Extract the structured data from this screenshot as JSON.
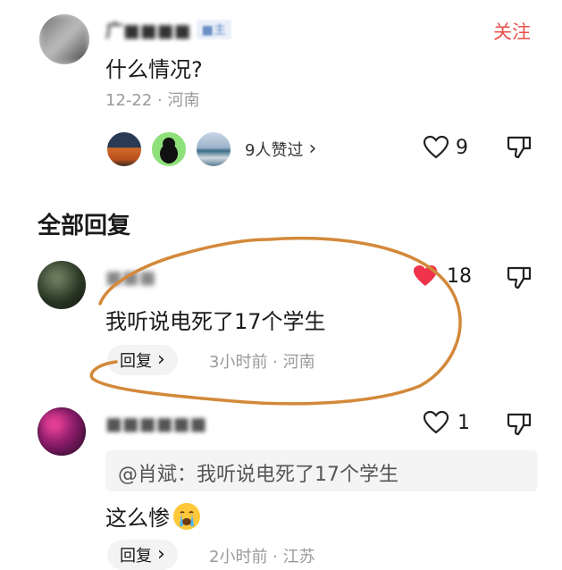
{
  "post": {
    "author_name": "广■■■■",
    "author_badge": "■主",
    "follow_label": "关注",
    "text": "什么情况?",
    "meta": "12-22 · 河南",
    "likers_summary": "9人赞过",
    "likers_chevron": "›",
    "like_count": "9"
  },
  "section_title": "全部回复",
  "replies": [
    {
      "author_name": "■■■",
      "text": "我听说电死了17个学生",
      "like_count": "18",
      "reply_button": "回复",
      "reply_chevron": "›",
      "meta": "3小时前 · 河南"
    },
    {
      "author_name": "■■■■■■",
      "quote": "@肖斌：我听说电死了17个学生",
      "text": "这么惨",
      "emoji": "😭",
      "like_count": "1",
      "reply_button": "回复",
      "reply_chevron": "›",
      "meta": "2小时前 · 江苏"
    }
  ],
  "colors": {
    "follow": "#e5504a",
    "heart_filled": "#f0324a",
    "annotation": "#d3893a",
    "secondary_text": "#9a9a9a"
  }
}
